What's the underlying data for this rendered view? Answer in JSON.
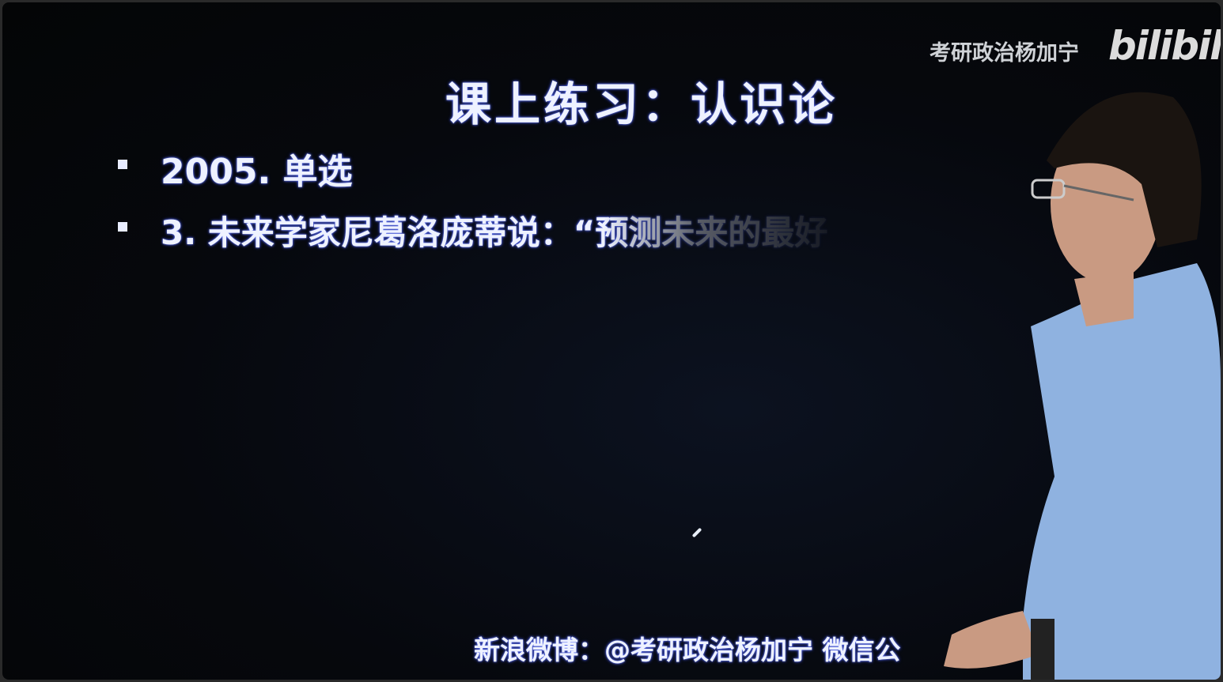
{
  "watermark": {
    "channel": "考研政治杨加宁",
    "logo": "bilibili"
  },
  "slide": {
    "title": "课上练习：认识论",
    "items": [
      "2005. 单选",
      "3. 未来学家尼葛洛庞蒂说：“预测未来的最好"
    ],
    "footer": "新浪微博：@考研政治杨加宁  微信公"
  },
  "colors": {
    "background": "#06080d",
    "text": "#eef2ff",
    "shirt": "#8fb2e0"
  }
}
